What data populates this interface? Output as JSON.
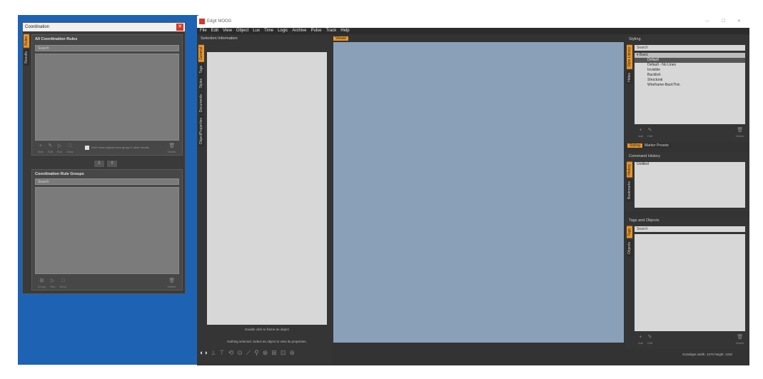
{
  "coordination": {
    "title": "Coordination",
    "close_glyph": "✕",
    "side_tabs": [
      "Rules",
      "Results"
    ],
    "rules_section_title": "All Coordination Rules",
    "rules_search_placeholder": "Search",
    "rule_actions": [
      {
        "icon": "+",
        "label": "New"
      },
      {
        "icon": "✎",
        "label": "Edit"
      },
      {
        "icon": "▷",
        "label": "Run"
      },
      {
        "icon": "□",
        "label": "Clear"
      }
    ],
    "checkbox_label": "Don't clear objects from group in other results",
    "delete_label": "Delete",
    "arrow_down": "⇩",
    "arrow_up": "⇧",
    "groups_section_title": "Coordination Rule Groups",
    "groups_search_placeholder": "Search",
    "group_actions": [
      {
        "icon": "⊞",
        "label": "Group"
      },
      {
        "icon": "▷",
        "label": "Run"
      },
      {
        "icon": "□",
        "label": "Clear"
      }
    ]
  },
  "app": {
    "title": "Edgit MOOG",
    "window_controls": [
      "—",
      "☐",
      "✕"
    ],
    "menu": [
      "File",
      "Edit",
      "View",
      "Object",
      "Lux",
      "Time",
      "Logic",
      "Archive",
      "Pulse",
      "Track",
      "Help"
    ],
    "selection_panel": {
      "title": "Selection Information",
      "side_tabs": [
        "General",
        "Tags",
        "Styles",
        "Documents",
        "ObjectProperties"
      ],
      "hint": "Double click to frame an object",
      "status": "Nothing selected. Select an object to view its properties."
    },
    "viewport_tab": "Viewer",
    "styling": {
      "title": "Styling",
      "side_tabs": [
        "Style Library",
        "Hides"
      ],
      "search_placeholder": "Search",
      "group": "Basic",
      "items": [
        "Default",
        "Default - No Lines",
        "Invisible",
        "Backlish",
        "Structural",
        "Wireframe-BackThin"
      ],
      "actions": [
        {
          "icon": "+",
          "label": "Add"
        },
        {
          "icon": "✎",
          "label": "Edit"
        }
      ],
      "delete_label": "Delete",
      "bottom_tabs": [
        "Styling",
        "Marker Presets"
      ]
    },
    "command_history": {
      "title": "Command History",
      "side_tabs": [
        "History",
        "Bookmarks"
      ],
      "first_item": "Untitled"
    },
    "tags_objects": {
      "title": "Tags and Objects",
      "side_tabs": [
        "Tags",
        "Objects"
      ],
      "search_placeholder": "Search",
      "actions": [
        {
          "icon": "+",
          "label": "Add"
        },
        {
          "icon": "✎",
          "label": "Edit"
        }
      ],
      "delete_label": "Delete"
    },
    "status_bar": {
      "size_text": "GLWidget width: 1370 height: 1220"
    },
    "bottom_tool_glyphs": [
      "◐◑",
      "⟂",
      "⊤",
      "⟲",
      "⊙",
      "⟋",
      "⚲",
      "⊕",
      "⊞",
      "⊡",
      "⊛"
    ]
  }
}
